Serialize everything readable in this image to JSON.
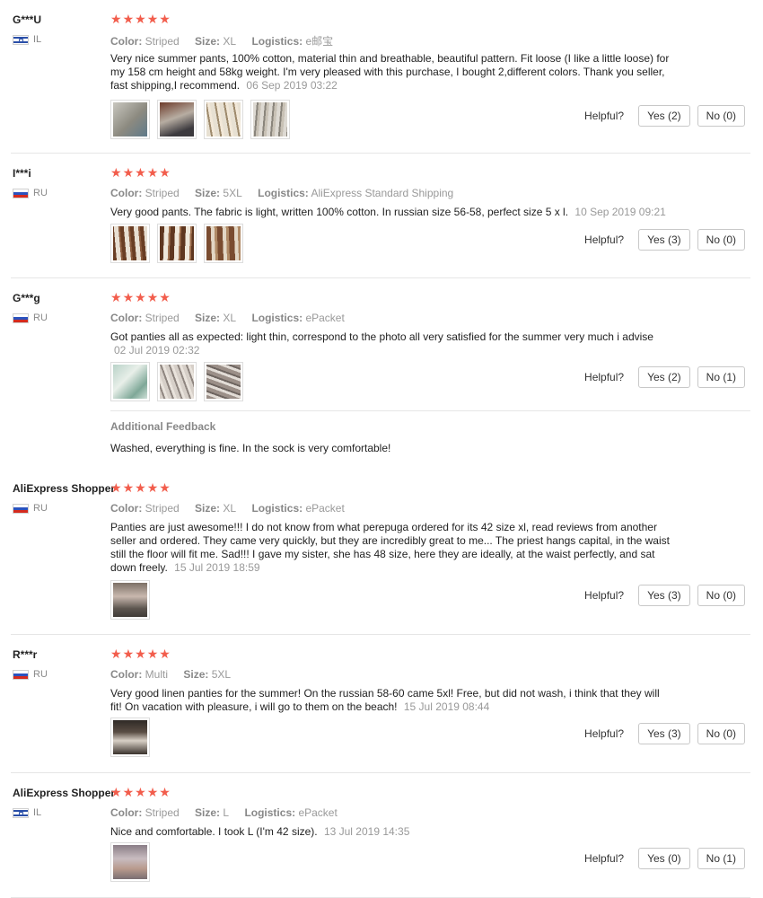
{
  "labels": {
    "color": "Color:",
    "size": "Size:",
    "logistics": "Logistics:",
    "helpful": "Helpful?",
    "additional_feedback": "Additional Feedback",
    "star_glyph": "★"
  },
  "colors": {
    "star": "#f25d4c",
    "flag_il_blue": "#2a4fa8",
    "flag_ru_blue": "#2a52be",
    "flag_ru_red": "#d52b1e"
  },
  "reviews": [
    {
      "user": "G***U",
      "country": "IL",
      "flag": "flag-il",
      "rating": 5,
      "color": "Striped",
      "size": "XL",
      "logistics": "e邮宝",
      "text": "Very nice summer pants, 100% cotton, material thin and breathable, beautiful pattern. Fit loose (I like a little loose) for my 158 cm height and 58kg weight. I'm very pleased with this purchase, I bought 2,different colors. Thank you seller, fast shipping,I recommend.",
      "date": "06 Sep 2019 03:22",
      "photos": [
        "photo-pants-1",
        "photo-pants-2",
        "photo-pants-3",
        "photo-pants-4"
      ],
      "yes": "Yes (2)",
      "no": "No (0)"
    },
    {
      "user": "I***i",
      "country": "RU",
      "flag": "flag-ru",
      "rating": 5,
      "color": "Striped",
      "size": "5XL",
      "logistics": "AliExpress Standard Shipping",
      "text": "Very good pants. The fabric is light, written 100% cotton. In russian size 56-58, perfect size 5 x l.",
      "date": "10 Sep 2019 09:21",
      "photos": [
        "photo-pants-1",
        "photo-pants-2",
        "photo-pants-3"
      ],
      "yes": "Yes (3)",
      "no": "No (0)"
    },
    {
      "user": "G***g",
      "country": "RU",
      "flag": "flag-ru",
      "rating": 5,
      "color": "Striped",
      "size": "XL",
      "logistics": "ePacket",
      "text": "Got panties all as expected: light thin, correspond to the photo all very satisfied for the summer very much i advise",
      "date": "02 Jul 2019 02:32",
      "photos": [
        "photo-package-1",
        "photo-package-2",
        "photo-package-3"
      ],
      "yes": "Yes (2)",
      "no": "No (1)",
      "additional": "Washed, everything is fine. In the sock is very comfortable!"
    },
    {
      "user": "AliExpress Shopper",
      "country": "RU",
      "flag": "flag-ru",
      "rating": 5,
      "color": "Striped",
      "size": "XL",
      "logistics": "ePacket",
      "text": "Panties are just awesome!!! I do not know from what perepuga ordered for its 42 size xl, read reviews from another seller and ordered. They came very quickly, but they are incredibly great to me... The priest hangs capital, in the waist still the floor will fit me. Sad!!! I gave my sister, she has 48 size, here they are ideally, at the waist perfectly, and sat down freely.",
      "date": "15 Jul 2019 18:59",
      "photos": [
        "photo-wearing-1"
      ],
      "yes": "Yes (3)",
      "no": "No (0)"
    },
    {
      "user": "R***r",
      "country": "RU",
      "flag": "flag-ru",
      "rating": 5,
      "color": "Multi",
      "size": "5XL",
      "text": "Very good linen panties for the summer! On the russian 58-60 came 5xl! Free, but did not wash, i think that they will fit! On vacation with pleasure, i will go to them on the beach!",
      "date": "15 Jul 2019 08:44",
      "photos": [
        "photo-wearing-2"
      ],
      "yes": "Yes (3)",
      "no": "No (0)"
    },
    {
      "user": "AliExpress Shopper",
      "country": "IL",
      "flag": "flag-il",
      "rating": 5,
      "color": "Striped",
      "size": "L",
      "logistics": "ePacket",
      "text": "Nice and comfortable. I took L (I'm 42 size).",
      "date": "13 Jul 2019 14:35",
      "photos": [
        "photo-wearing-3"
      ],
      "yes": "Yes (0)",
      "no": "No (1)"
    }
  ]
}
